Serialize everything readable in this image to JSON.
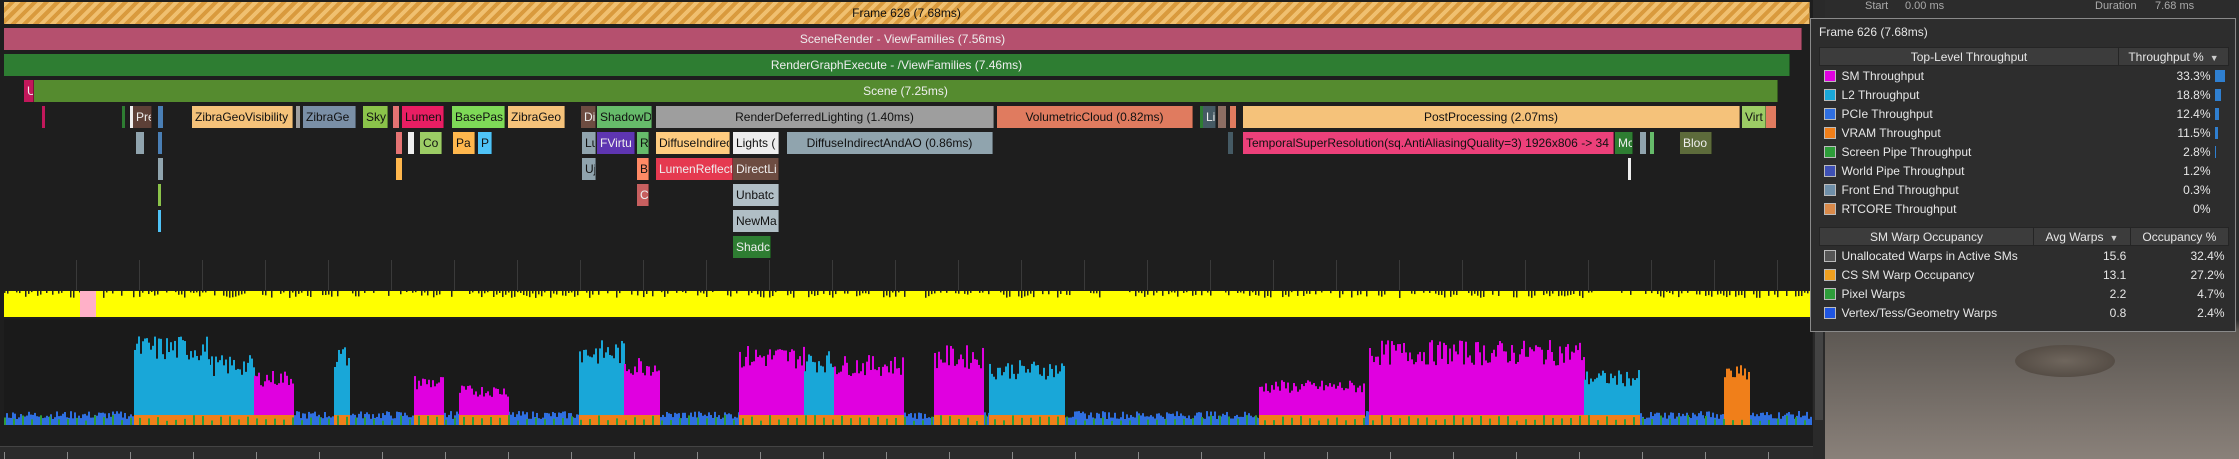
{
  "preview": {
    "start_label": "Start",
    "start_value": "0.00 ms",
    "duration_label": "Duration",
    "duration_value": "7.68 ms"
  },
  "rows": [
    {
      "bars": [
        {
          "label": "Frame 626 (7.68ms)",
          "kind": "frame"
        }
      ]
    },
    {
      "bars": [
        {
          "label": "SceneRender - ViewFamilies (7.56ms)",
          "color": "#b5506e"
        }
      ]
    },
    {
      "bars": [
        {
          "label": "RenderGraphExecute - /ViewFamilies (7.46ms)",
          "color": "#2e7d32"
        }
      ]
    },
    {
      "bars": [
        {
          "label": "Scene (7.25ms)",
          "color": "#558b2f"
        },
        {
          "label": "U",
          "color": "#c2185b"
        }
      ]
    },
    {
      "bars": [
        {
          "label": "Pre",
          "color": "#8d6e63"
        },
        {
          "label": "ZibraGeoVisibility",
          "color": "#f5c27a"
        },
        {
          "label": "ZibraGe",
          "color": "#7a8fa6"
        },
        {
          "label": "Sky",
          "color": "#8bc34a"
        },
        {
          "label": "Lumen",
          "color": "#e91e63"
        },
        {
          "label": "BasePas",
          "color": "#7ed957"
        },
        {
          "label": "ZibraGeo",
          "color": "#f5c27a"
        },
        {
          "label": "Di",
          "color": "#ba68c8"
        },
        {
          "label": "ShadowD",
          "color": "#66bb6a"
        },
        {
          "label": "RenderDeferredLighting (1.40ms)",
          "color": "#9e9e9e"
        },
        {
          "label": "VolumetricCloud (0.82ms)",
          "color": "#e07b5f"
        },
        {
          "label": "Li",
          "color": "#b0bec5"
        },
        {
          "label": "PostProcessing (2.07ms)",
          "color": "#f5c27a"
        },
        {
          "label": "Virt",
          "color": "#9ccc65"
        }
      ]
    },
    {
      "bars": [
        {
          "label": "Co",
          "color": "#9ccc65"
        },
        {
          "label": "Pa",
          "color": "#ffb74d"
        },
        {
          "label": "P",
          "color": "#4fc3f7"
        },
        {
          "label": "Lu",
          "color": "#90a4ae"
        },
        {
          "label": "FVirtu",
          "color": "#9575cd"
        },
        {
          "label": "R",
          "color": "#66bb6a"
        },
        {
          "label": "DiffuseIndirec",
          "color": "#ffcc80"
        },
        {
          "label": "Lights (",
          "color": "#eeeeee"
        },
        {
          "label": "DiffuseIndirectAndAO (0.86ms)",
          "color": "#90a4ae"
        },
        {
          "label": "TemporalSuperResolution(sq.AntiAliasingQuality=3) 1926x806 -> 34",
          "color": "#ec407a"
        },
        {
          "label": "Mc",
          "color": "#43a047"
        },
        {
          "label": "Bloo",
          "color": "#7c8b5b"
        }
      ]
    },
    {
      "bars": [
        {
          "label": "Uj",
          "color": "#90a4ae"
        },
        {
          "label": "B",
          "color": "#ff8a65"
        },
        {
          "label": "LumenReflect",
          "color": "#e53950"
        },
        {
          "label": "DirectLi",
          "color": "#a1887f"
        }
      ]
    },
    {
      "bars": [
        {
          "label": "C",
          "color": "#e57373"
        },
        {
          "label": "Unbatc",
          "color": "#b0bec5"
        }
      ]
    },
    {
      "bars": [
        {
          "label": "NewMa",
          "color": "#b0bec5"
        }
      ]
    },
    {
      "bars": [
        {
          "label": "Shadc",
          "color": "#2e7d32"
        }
      ]
    }
  ],
  "tooltip": {
    "title": "Frame 626 (7.68ms)",
    "throughput": {
      "col1": "Top-Level Throughput",
      "col2": "Throughput %",
      "rows": [
        {
          "name": "SM Throughput",
          "value": "33.3%",
          "pct": 33.3,
          "color": "#e000e0"
        },
        {
          "name": "L2 Throughput",
          "value": "18.8%",
          "pct": 18.8,
          "color": "#19a7d8"
        },
        {
          "name": "PCIe Throughput",
          "value": "12.4%",
          "pct": 12.4,
          "color": "#2f6fe0"
        },
        {
          "name": "VRAM Throughput",
          "value": "11.5%",
          "pct": 11.5,
          "color": "#f07f1a"
        },
        {
          "name": "Screen Pipe Throughput",
          "value": "2.8%",
          "pct": 2.8,
          "color": "#2e9d3a"
        },
        {
          "name": "World Pipe Throughput",
          "value": "1.2%",
          "pct": 1.2,
          "color": "#3f51b5"
        },
        {
          "name": "Front End Throughput",
          "value": "0.3%",
          "pct": 0.3,
          "color": "#6f8fa8"
        },
        {
          "name": "RTCORE Throughput",
          "value": "0%",
          "pct": 0,
          "color": "#d98a4a"
        }
      ]
    },
    "occupancy": {
      "col1": "SM Warp Occupancy",
      "col2": "Avg Warps",
      "col3": "Occupancy %",
      "rows": [
        {
          "name": "Unallocated Warps in Active SMs",
          "avg": "15.6",
          "pct": "32.4%",
          "color": "#555555"
        },
        {
          "name": "CS SM Warp Occupancy",
          "avg": "13.1",
          "pct": "27.2%",
          "color": "#f0a020"
        },
        {
          "name": "Pixel Warps",
          "avg": "2.2",
          "pct": "4.7%",
          "color": "#2e9d3a"
        },
        {
          "name": "Vertex/Tess/Geometry Warps",
          "avg": "0.8",
          "pct": "2.4%",
          "color": "#1f55e0"
        }
      ]
    }
  }
}
